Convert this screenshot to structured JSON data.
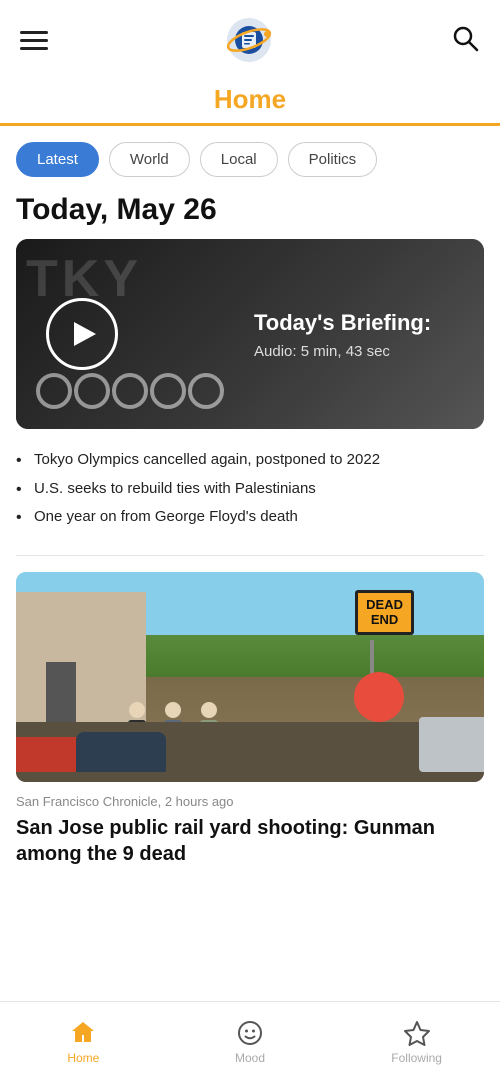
{
  "header": {
    "menu_aria": "menu",
    "search_aria": "search",
    "logo_aria": "app logo"
  },
  "page_title": "Home",
  "title_underline": true,
  "filter_tabs": [
    {
      "label": "Latest",
      "active": true
    },
    {
      "label": "World",
      "active": false
    },
    {
      "label": "Local",
      "active": false
    },
    {
      "label": "Politics",
      "active": false
    }
  ],
  "date_heading": "Today, May 26",
  "briefing": {
    "title": "Today's Briefing:",
    "subtitle": "Audio: 5 min, 43 sec",
    "play_aria": "play briefing"
  },
  "briefing_bullets": [
    "Tokyo Olympics cancelled again, postponed to 2022",
    "U.S. seeks to rebuild ties with Palestinians",
    "One year on from George Floyd's death"
  ],
  "news_article": {
    "source": "San Francisco Chronicle, 2 hours ago",
    "headline": "San Jose public rail yard shooting: Gunman among the 9 dead",
    "dead_end_sign": "DEAD\nEND"
  },
  "bottom_nav": [
    {
      "label": "Home",
      "active": true,
      "icon": "home-icon"
    },
    {
      "label": "Mood",
      "active": false,
      "icon": "mood-icon"
    },
    {
      "label": "Following",
      "active": false,
      "icon": "following-icon"
    }
  ]
}
